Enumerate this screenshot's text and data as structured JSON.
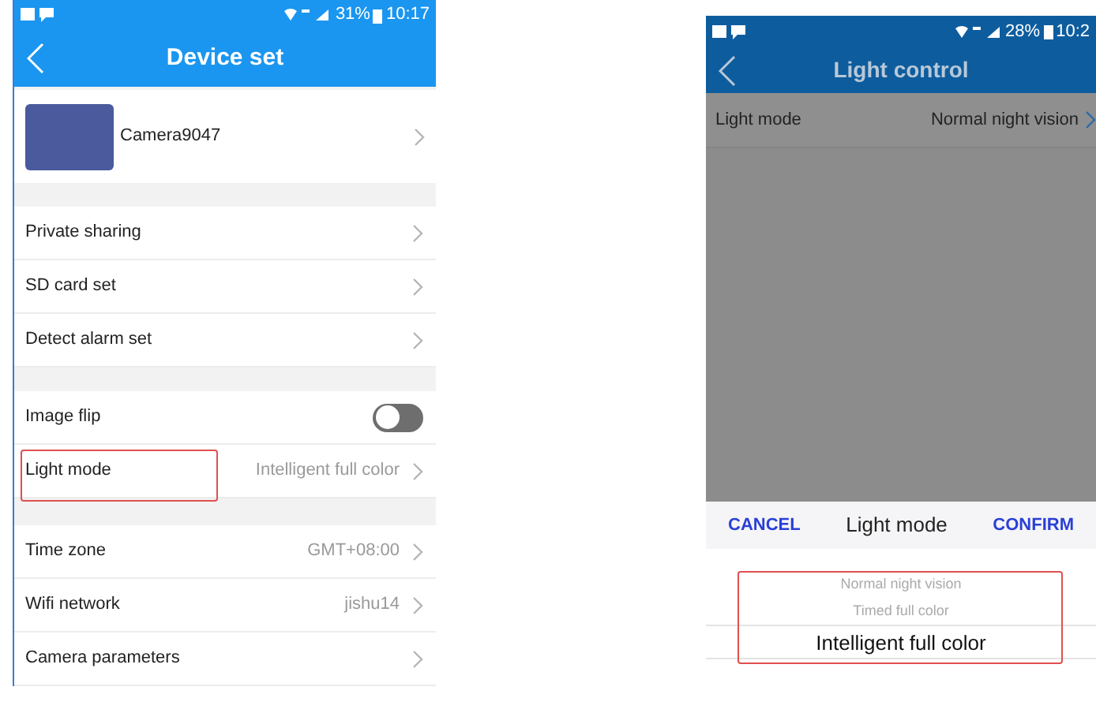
{
  "device_screen": {
    "status_bar": {
      "battery": "31%",
      "time": "10:17"
    },
    "title": "Device set",
    "camera": {
      "name": "Camera9047"
    },
    "groups": [
      [
        {
          "kind": "link",
          "label": "Private sharing",
          "highlighted": false
        },
        {
          "kind": "link",
          "label": "SD card set",
          "highlighted": false
        },
        {
          "kind": "link",
          "label": "Detect alarm set",
          "highlighted": false
        }
      ],
      [
        {
          "kind": "toggle",
          "label": "Image flip",
          "on": false,
          "highlighted": false
        },
        {
          "kind": "link",
          "label": "Light mode",
          "value": "Intelligent full color",
          "highlighted": true
        }
      ],
      [
        {
          "kind": "link",
          "label": "Time zone",
          "value": "GMT+08:00",
          "highlighted": false
        },
        {
          "kind": "link",
          "label": "Wifi network",
          "value": "jishu14",
          "highlighted": false
        },
        {
          "kind": "link",
          "label": "Camera parameters",
          "highlighted": false
        }
      ]
    ]
  },
  "light_screen": {
    "status_bar": {
      "battery": "28%",
      "time": "10:2"
    },
    "title": "Light control",
    "row": {
      "label": "Light mode",
      "value": "Normal night vision"
    },
    "picker": {
      "cancel": "CANCEL",
      "title": "Light mode",
      "confirm": "CONFIRM",
      "highlighted": true,
      "options": [
        {
          "label": "Normal night vision",
          "selected": false
        },
        {
          "label": "Timed full color",
          "selected": false
        },
        {
          "label": "Intelligent full color",
          "selected": true
        }
      ]
    }
  }
}
